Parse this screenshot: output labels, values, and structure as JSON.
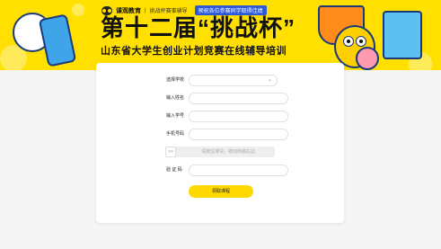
{
  "header": {
    "brand": "课观教育",
    "separator": "|",
    "tagline": "挑战杯赛事辅导",
    "notice": "预祝各位参赛同学取得佳绩",
    "title": "第十二届“挑战杯”",
    "subtitle": "山东省大学生创业计划竞赛在线辅导培训"
  },
  "form": {
    "school": {
      "label": "选择学校",
      "value": ""
    },
    "name": {
      "label": "输入姓名",
      "value": ""
    },
    "student_id": {
      "label": "输入学号",
      "value": ""
    },
    "phone": {
      "label": "手机号码",
      "value": ""
    },
    "slider": {
      "handle": ">>",
      "text": "请按住滑块，拖动到最右边"
    },
    "captcha": {
      "label": "验 证 码",
      "value": ""
    },
    "submit_label": "领取课程"
  },
  "colors": {
    "banner": "#ffe000",
    "accent_blue": "#2b58d6",
    "button": "#ffd800"
  }
}
